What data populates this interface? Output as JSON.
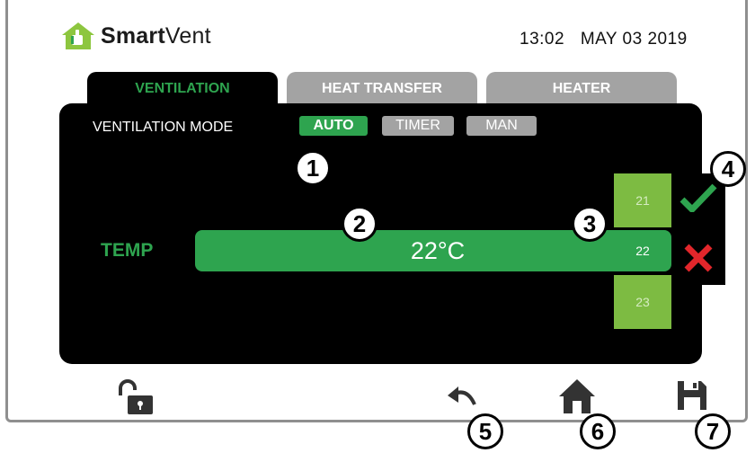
{
  "header": {
    "brand_bold": "Smart",
    "brand_regular": "Vent",
    "time": "13:02",
    "date": "MAY 03 2019"
  },
  "tabs": [
    {
      "label": "VENTILATION",
      "active": true
    },
    {
      "label": "HEAT TRANSFER",
      "active": false
    },
    {
      "label": "HEATER",
      "active": false
    }
  ],
  "ventilation_mode": {
    "label": "VENTILATION MODE",
    "options": [
      "AUTO",
      "TIMER",
      "MAN"
    ],
    "selected": "AUTO"
  },
  "temperature": {
    "label": "TEMP",
    "value": "22°C",
    "options": [
      "21",
      "22",
      "23"
    ],
    "selected": "22"
  },
  "callouts": [
    "1",
    "2",
    "3",
    "4",
    "5",
    "6",
    "7"
  ],
  "toolbar": {
    "icons": [
      "unlock-icon",
      "undo-icon",
      "home-icon",
      "save-icon"
    ]
  },
  "colors": {
    "accent_green": "#2ea44f",
    "option_green": "#7dbb42",
    "inactive_gray": "#a3a3a3",
    "panel_black": "#000000",
    "cancel_red": "#e2262b",
    "icon_gray": "#333333"
  }
}
